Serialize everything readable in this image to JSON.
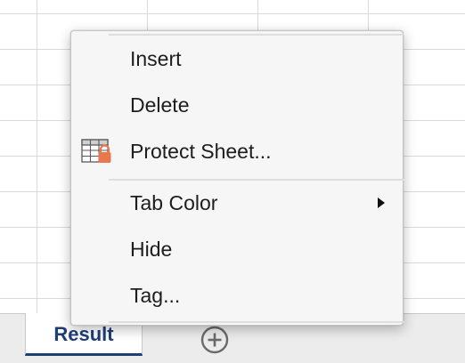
{
  "context_menu": {
    "items": [
      {
        "label": "Insert"
      },
      {
        "label": "Delete"
      },
      {
        "label": "Protect Sheet...",
        "icon": "protect-sheet-icon"
      },
      {
        "label": "Tab Color",
        "has_submenu": true
      },
      {
        "label": "Hide"
      },
      {
        "label": "Tag..."
      }
    ]
  },
  "sheet_tabs": {
    "active": "Result",
    "add_icon": "add-sheet-icon"
  },
  "colors": {
    "tab_accent": "#1f3e76",
    "lock_orange": "#e8774d"
  }
}
